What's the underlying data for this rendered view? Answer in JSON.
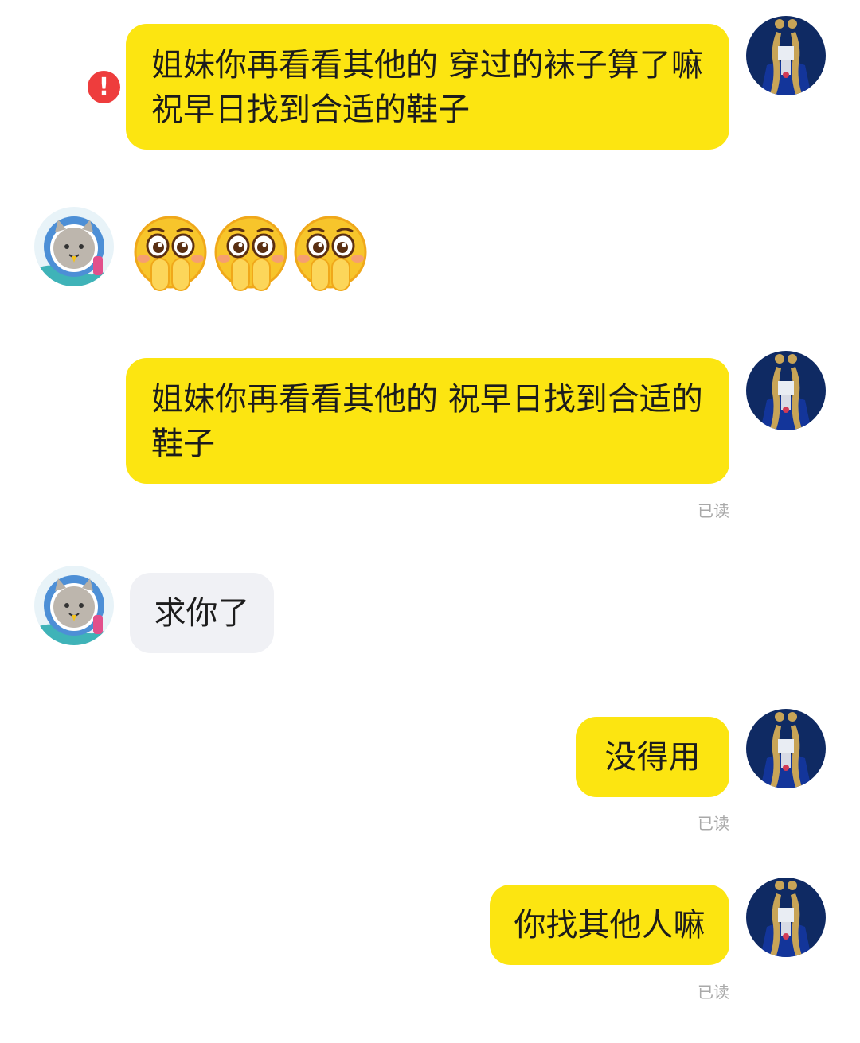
{
  "messages": [
    {
      "side": "right",
      "lines": [
        "姐妹你再看看其他的 穿过的袜子算了嘛",
        "祝早日找到合适的鞋子"
      ],
      "error": true,
      "error_glyph": "!"
    },
    {
      "side": "left",
      "emoji": [
        "pleading-hands-emoji",
        "pleading-hands-emoji",
        "pleading-hands-emoji"
      ]
    },
    {
      "side": "right",
      "lines": [
        "姐妹你再看看其他的 祝早日找到合适的",
        "鞋子"
      ],
      "receipt": "已读"
    },
    {
      "side": "left",
      "text": "求你了"
    },
    {
      "side": "right",
      "text": "没得用",
      "receipt": "已读"
    },
    {
      "side": "right",
      "text": "你找其他人嘛",
      "receipt": "已读"
    }
  ],
  "colors": {
    "my_bubble": "#fce511",
    "other_bubble": "#f0f1f5",
    "error": "#ee3d3d",
    "receipt": "#a9a9a9"
  },
  "icons": {
    "my_avatar": "sailor-moon-avatar",
    "other_avatar": "astronaut-cat-avatar",
    "error": "exclamation-icon"
  }
}
